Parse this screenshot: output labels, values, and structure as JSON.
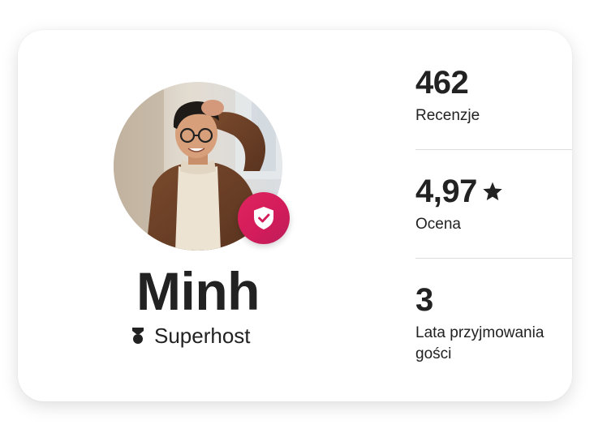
{
  "host": {
    "name": "Minh",
    "badge_label": "Superhost"
  },
  "stats": [
    {
      "value": "462",
      "label": "Recenzje"
    },
    {
      "value": "4,97",
      "label": "Ocena",
      "icon": "star-icon"
    },
    {
      "value": "3",
      "label": "Lata przyjmowania gości"
    }
  ],
  "colors": {
    "accent": "#D31C5B",
    "text": "#222222",
    "divider": "#DDDDDD"
  },
  "icons": {
    "verified": "shield-check-icon",
    "superhost": "superhost-medal-icon",
    "rating": "star-icon"
  }
}
